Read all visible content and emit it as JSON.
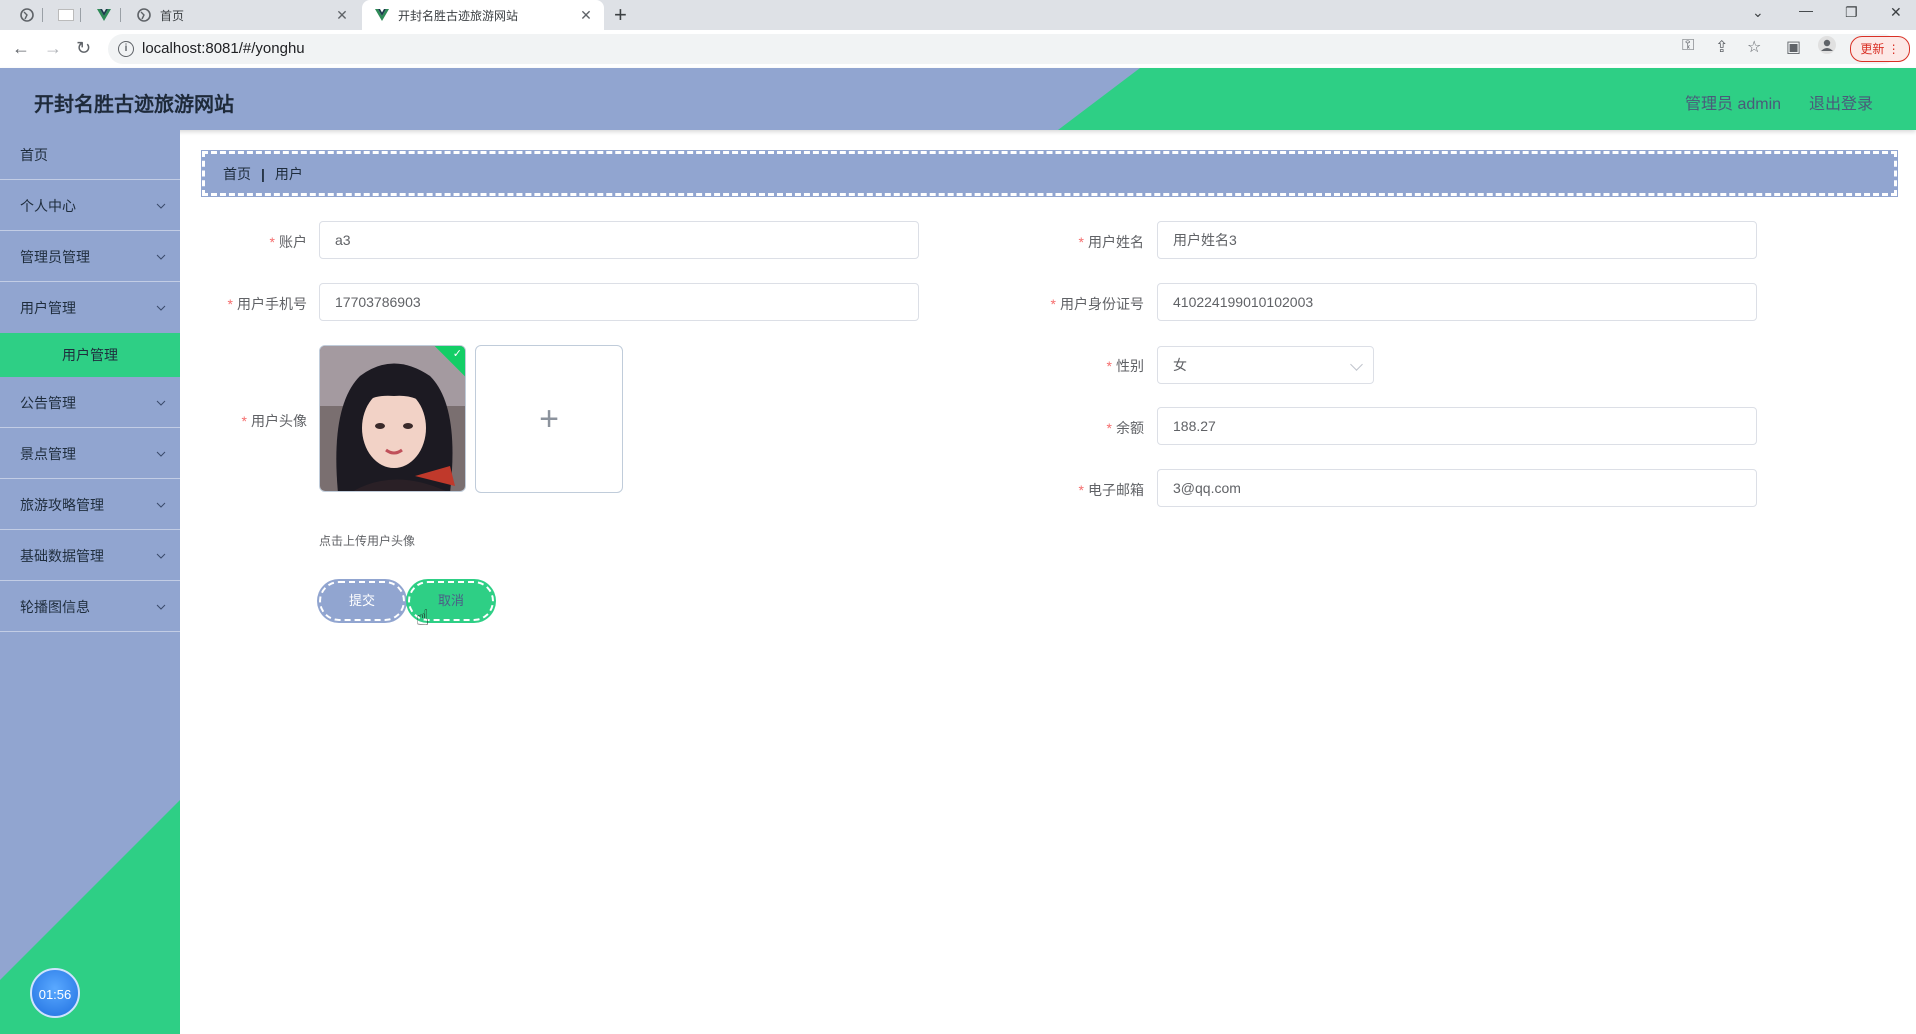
{
  "browser": {
    "tabs": [
      {
        "title": "首页",
        "active": false
      },
      {
        "title": "开封名胜古迹旅游网站",
        "active": true
      }
    ],
    "url": "localhost:8081/#/yonghu",
    "update_label": "更新"
  },
  "header": {
    "site_title": "开封名胜古迹旅游网站",
    "admin_label": "管理员 admin",
    "logout_label": "退出登录"
  },
  "sidebar": {
    "items": [
      {
        "label": "首页",
        "has_children": false
      },
      {
        "label": "个人中心",
        "has_children": true
      },
      {
        "label": "管理员管理",
        "has_children": true
      },
      {
        "label": "用户管理",
        "has_children": true,
        "open": true
      },
      {
        "label": "公告管理",
        "has_children": true
      },
      {
        "label": "景点管理",
        "has_children": true
      },
      {
        "label": "旅游攻略管理",
        "has_children": true
      },
      {
        "label": "基础数据管理",
        "has_children": true
      },
      {
        "label": "轮播图信息",
        "has_children": true
      }
    ],
    "active_subitem": "用户管理",
    "timer": "01:56"
  },
  "breadcrumb": {
    "items": [
      "首页",
      "用户"
    ],
    "separator": "|"
  },
  "form": {
    "account_label": "账户",
    "account_value": "a3",
    "name_label": "用户姓名",
    "name_value": "用户姓名3",
    "phone_label": "用户手机号",
    "phone_value": "17703786903",
    "idcard_label": "用户身份证号",
    "idcard_value": "410224199010102003",
    "avatar_label": "用户头像",
    "gender_label": "性别",
    "gender_value": "女",
    "balance_label": "余额",
    "balance_value": "188.27",
    "email_label": "电子邮箱",
    "email_value": "3@qq.com",
    "upload_tip": "点击上传用户头像",
    "required_mark": "*",
    "submit_label": "提交",
    "cancel_label": "取消"
  },
  "colors": {
    "primary": "#91a5d0",
    "accent": "#2ecf85",
    "required": "#f56c6c"
  }
}
